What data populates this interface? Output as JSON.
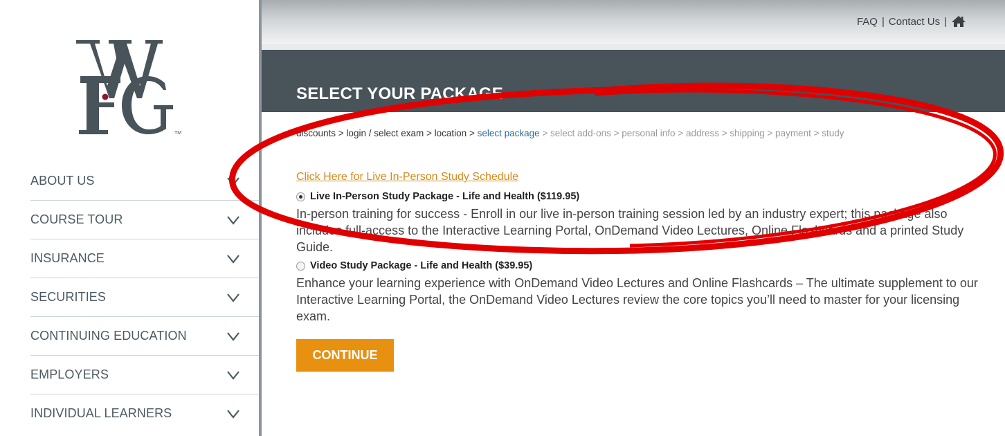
{
  "brand": {
    "logo_letters": "WFG",
    "trademark": "TM",
    "primary_color": "#48535a",
    "accent_dot_color": "#8b1a2e"
  },
  "sidebar": {
    "items": [
      {
        "label": "ABOUT US",
        "icon": "chevron-down-icon"
      },
      {
        "label": "COURSE TOUR",
        "icon": "chevron-down-icon"
      },
      {
        "label": "INSURANCE",
        "icon": "chevron-down-icon"
      },
      {
        "label": "SECURITIES",
        "icon": "chevron-down-icon"
      },
      {
        "label": "CONTINUING EDUCATION",
        "icon": "chevron-down-icon"
      },
      {
        "label": "EMPLOYERS",
        "icon": "chevron-down-icon"
      },
      {
        "label": "INDIVIDUAL LEARNERS",
        "icon": "chevron-down-icon"
      }
    ]
  },
  "topbar": {
    "faq": "FAQ",
    "separator": "|",
    "contact": "Contact Us",
    "home_icon": "home-icon"
  },
  "header": {
    "title": "SELECT YOUR PACKAGE"
  },
  "breadcrumb": {
    "separator": " > ",
    "steps": [
      {
        "label": "discounts",
        "state": "done"
      },
      {
        "label": "login / select exam",
        "state": "done"
      },
      {
        "label": "location",
        "state": "done"
      },
      {
        "label": "select package",
        "state": "current"
      },
      {
        "label": "select add-ons",
        "state": "todo"
      },
      {
        "label": "personal info",
        "state": "todo"
      },
      {
        "label": "address",
        "state": "todo"
      },
      {
        "label": "shipping",
        "state": "todo"
      },
      {
        "label": "payment",
        "state": "todo"
      },
      {
        "label": "study",
        "state": "todo"
      }
    ]
  },
  "schedule_link": "Click Here for Live In-Person Study Schedule",
  "packages": [
    {
      "title": "Live In-Person Study Package - Life and Health ($119.95)",
      "selected": true,
      "description": "In-person training for success - Enroll in our live in-person training session led by an industry expert; this package also includes full-access to the Interactive Learning Portal, OnDemand Video Lectures, Online Flashcards and a printed Study Guide."
    },
    {
      "title": "Video Study Package - Life and Health ($39.95)",
      "selected": false,
      "description": "Enhance your learning experience with OnDemand Video Lectures and Online Flashcards – The ultimate supplement to our Interactive Learning Portal, the OnDemand Video Lectures review the core topics you’ll need to master for your licensing exam."
    }
  ],
  "continue_label": "CONTINUE",
  "colors": {
    "continue_button": "#e8900f",
    "link": "#d48a1a",
    "annotation": "#e00000"
  }
}
